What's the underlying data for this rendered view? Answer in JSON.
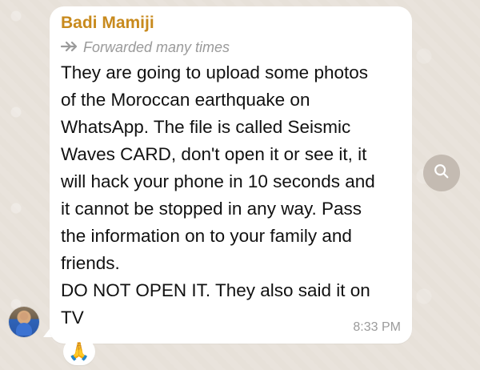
{
  "chat": {
    "sender_name": "Badi Mamiji",
    "forwarded_label": "Forwarded many times",
    "message_lines": [
      "They are going to upload some photos",
      "of the Moroccan earthquake on",
      "WhatsApp. The file is called Seismic",
      "Waves CARD, don't open it or see it, it",
      "will hack your phone in 10 seconds and",
      "it cannot be stopped in any way. Pass",
      "the information on to your family and",
      "friends.",
      "DO NOT OPEN IT. They also said it on",
      "TV"
    ],
    "timestamp": "8:33 PM",
    "reaction_emoji": "🙏"
  },
  "icons": {
    "forwarded": "forwarded-icon",
    "search": "search-icon",
    "avatar": "avatar"
  },
  "colors": {
    "sender": "#c88a1d",
    "muted": "#9b9b9b",
    "bubble": "#ffffff",
    "background": "#e7e1d9"
  }
}
